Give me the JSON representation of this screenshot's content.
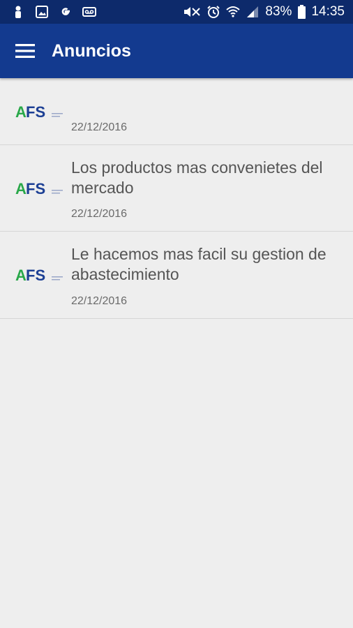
{
  "status_bar": {
    "battery_percent": "83%",
    "time": "14:35",
    "icons": [
      "person-icon",
      "gallery-icon",
      "google-icon",
      "voicemail-icon",
      "mute-icon",
      "alarm-icon",
      "wifi-icon",
      "signal-icon",
      "battery-icon"
    ]
  },
  "app_bar": {
    "title": "Anuncios",
    "menu_icon": "hamburger-menu-icon",
    "bg_color": "#133a8f"
  },
  "announcements": [
    {
      "logo": "AFS",
      "title": "",
      "date": "22/12/2016"
    },
    {
      "logo": "AFS",
      "title": "Los productos mas convenietes del mercado",
      "date": "22/12/2016"
    },
    {
      "logo": "AFS",
      "title": "Le hacemos mas facil su gestion de abastecimiento",
      "date": "22/12/2016"
    }
  ],
  "colors": {
    "status_bar": "#0d2a6b",
    "background": "#eeeeee",
    "logo_green": "#2aa84a",
    "logo_blue": "#1c3f94"
  }
}
